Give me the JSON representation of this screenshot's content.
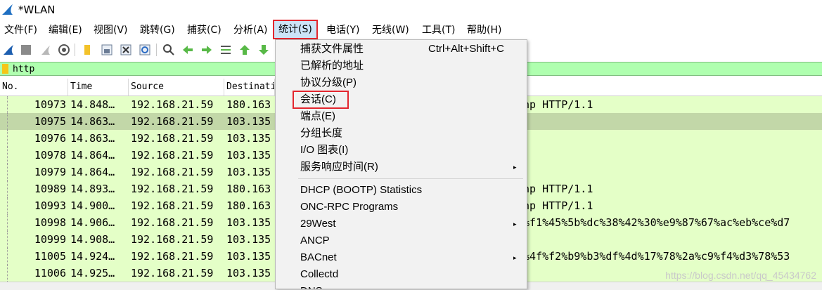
{
  "window": {
    "title": "*WLAN"
  },
  "menubar": {
    "items": [
      {
        "label": "文件(F)"
      },
      {
        "label": "编辑(E)"
      },
      {
        "label": "视图(V)"
      },
      {
        "label": "跳转(G)"
      },
      {
        "label": "捕获(C)"
      },
      {
        "label": "分析(A)"
      },
      {
        "label": "统计(S)"
      },
      {
        "label": "电话(Y)"
      },
      {
        "label": "无线(W)"
      },
      {
        "label": "工具(T)"
      },
      {
        "label": "帮助(H)"
      }
    ]
  },
  "filter": {
    "value": "http"
  },
  "packet_list": {
    "columns": [
      "No.",
      "Time",
      "Source",
      "Destinati"
    ],
    "rows": [
      {
        "no": "10973",
        "time": "14.848…",
        "source": "192.168.21.59",
        "dest": "180.163",
        "info": "ohp HTTP/1.1"
      },
      {
        "no": "10975",
        "time": "14.863…",
        "source": "192.168.21.59",
        "dest": "103.135",
        "info": ""
      },
      {
        "no": "10976",
        "time": "14.863…",
        "source": "192.168.21.59",
        "dest": "103.135",
        "info": ""
      },
      {
        "no": "10978",
        "time": "14.864…",
        "source": "192.168.21.59",
        "dest": "103.135",
        "info": ""
      },
      {
        "no": "10979",
        "time": "14.864…",
        "source": "192.168.21.59",
        "dest": "103.135",
        "info": ""
      },
      {
        "no": "10989",
        "time": "14.893…",
        "source": "192.168.21.59",
        "dest": "180.163",
        "info": "ohp HTTP/1.1"
      },
      {
        "no": "10993",
        "time": "14.900…",
        "source": "192.168.21.59",
        "dest": "180.163",
        "info": "ohp HTTP/1.1"
      },
      {
        "no": "10998",
        "time": "14.906…",
        "source": "192.168.21.59",
        "dest": "103.135",
        "info": "3%f1%45%5b%dc%38%42%30%e9%87%67%ac%eb%ce%d7"
      },
      {
        "no": "10999",
        "time": "14.908…",
        "source": "192.168.21.59",
        "dest": "103.135",
        "info": ""
      },
      {
        "no": "11005",
        "time": "14.924…",
        "source": "192.168.21.59",
        "dest": "103.135",
        "info": "3%4f%f2%b9%b3%df%4d%17%78%2a%c9%f4%d3%78%53"
      },
      {
        "no": "11006",
        "time": "14.925…",
        "source": "192.168.21.59",
        "dest": "103.135",
        "info": ""
      }
    ]
  },
  "statistics_menu": {
    "items": [
      {
        "label": "捕获文件属性",
        "shortcut": "Ctrl+Alt+Shift+C"
      },
      {
        "label": "已解析的地址"
      },
      {
        "label": "协议分级(P)"
      },
      {
        "label": "会话(C)"
      },
      {
        "label": "端点(E)"
      },
      {
        "label": "分组长度"
      },
      {
        "label": "I/O 图表(I)"
      },
      {
        "label": "服务响应时间(R)",
        "submenu": "▸"
      },
      {
        "label": "DHCP (BOOTP) Statistics"
      },
      {
        "label": "ONC-RPC Programs"
      },
      {
        "label": "29West",
        "submenu": "▸"
      },
      {
        "label": "ANCP"
      },
      {
        "label": "BACnet",
        "submenu": "▸"
      },
      {
        "label": "Collectd"
      },
      {
        "label": "DNS"
      }
    ]
  },
  "watermark": "https://blog.csdn.net/qq_45434762",
  "colors": {
    "highlight_box": "#e3262e",
    "filter_bg": "#afffaf",
    "row_bg": "#e4ffc7",
    "row_selected_bg": "#c2d7a8"
  }
}
